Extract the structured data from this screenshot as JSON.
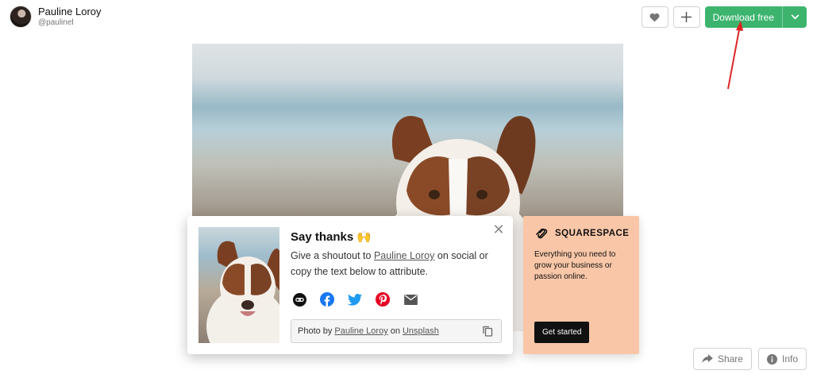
{
  "author": {
    "name": "Pauline Loroy",
    "handle": "@paulinel"
  },
  "toolbar": {
    "like_icon": "heart-icon",
    "add_icon": "plus-icon",
    "download_label": "Download free",
    "download_caret_icon": "chevron-down-icon",
    "download_color": "#3cb46e"
  },
  "thanks_panel": {
    "title": "Say thanks 🙌",
    "desc_prefix": "Give a shoutout to",
    "desc_link": "Pauline Loroy",
    "desc_suffix": "on social or copy the text below to attribute.",
    "socials": [
      "link-icon",
      "facebook-icon",
      "twitter-icon",
      "pinterest-icon",
      "email-icon"
    ],
    "attribution": {
      "prefix": "Photo by",
      "author_link": "Pauline Loroy",
      "middle": "on",
      "site_link": "Unsplash"
    }
  },
  "ad": {
    "brand": "SQUARESPACE",
    "text": "Everything you need to grow your business or passion online.",
    "cta": "Get started",
    "background": "#f9c7a8"
  },
  "bottom_actions": {
    "share": "Share",
    "info": "Info"
  }
}
